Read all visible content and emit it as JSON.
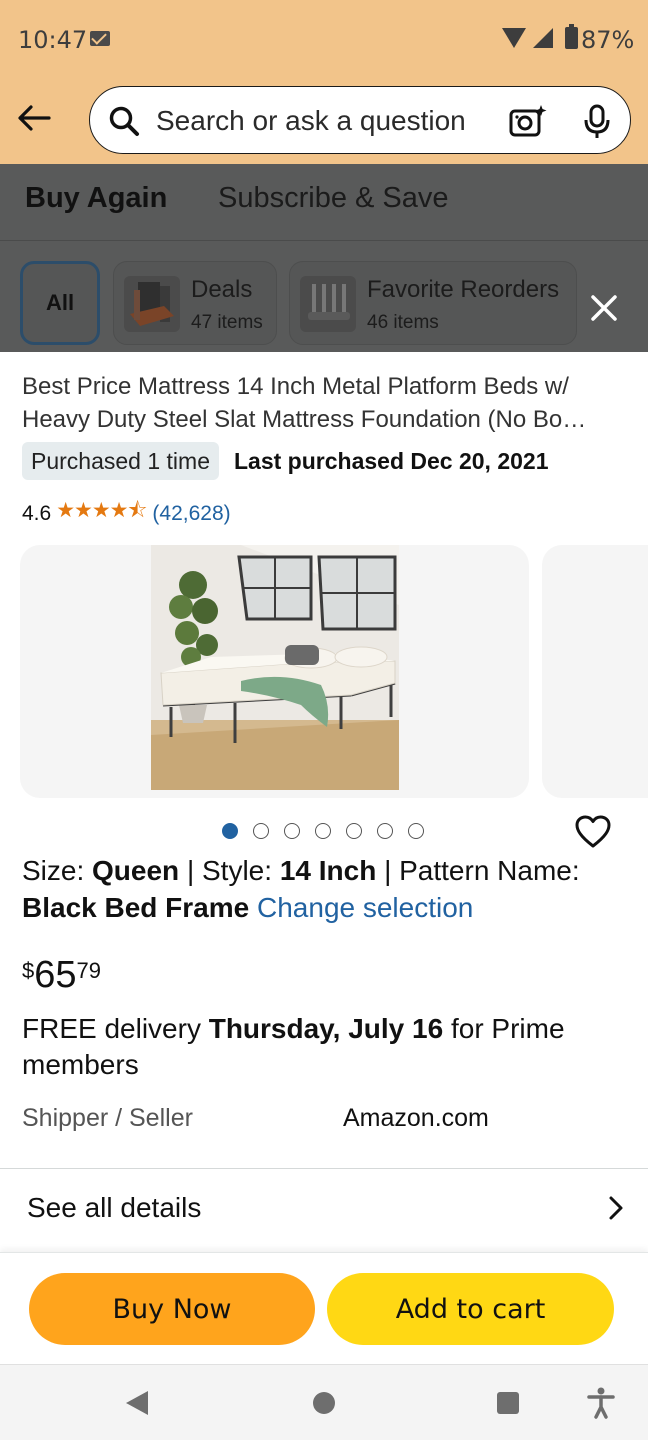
{
  "status_bar": {
    "time": "10:47",
    "battery": "87%"
  },
  "search": {
    "placeholder": "Search or ask a question"
  },
  "tabs": {
    "buy_again": "Buy Again",
    "subscribe_save": "Subscribe & Save"
  },
  "chips": {
    "all": "All",
    "deals": {
      "title": "Deals",
      "count": "47 items"
    },
    "favorite_reorders": {
      "title": "Favorite Reorders",
      "count": "46 items"
    }
  },
  "product": {
    "title": "Best Price Mattress 14 Inch Metal Platform Beds w/ Heavy Duty Steel Slat Mattress Foundation (No Bo…",
    "purchased_badge": "Purchased 1 time",
    "last_purchased": "Last purchased Dec 20, 2021",
    "rating": "4.6",
    "stars": "★★★★⯪",
    "rating_fraction": 0.92,
    "review_count": "(42,628)",
    "image_count": 7,
    "active_image": 1,
    "variant": {
      "size_label": "Size: ",
      "size_value": "Queen",
      "style_label": " | Style: ",
      "style_value": "14 Inch",
      "pattern_label": " | Pattern Name: ",
      "pattern_value": "Black Bed Frame",
      "change_link": "Change selection"
    },
    "price": {
      "symbol": "$",
      "whole": "65",
      "fraction": "79"
    },
    "delivery": {
      "prefix": "FREE delivery ",
      "date": "Thursday, July 16",
      "suffix": " for Prime members"
    },
    "shipper_label": "Shipper / Seller",
    "shipper_value": "Amazon.com"
  },
  "see_all_details": "See all details",
  "buttons": {
    "buy_now": "Buy Now",
    "add_to_cart": "Add to cart"
  },
  "colors": {
    "header_bg": "#f2c48a",
    "overlay": "#595a5a",
    "buy_now": "#ffa41c",
    "add_to_cart": "#ffd814",
    "link": "#2162a1",
    "star": "#e47911"
  }
}
